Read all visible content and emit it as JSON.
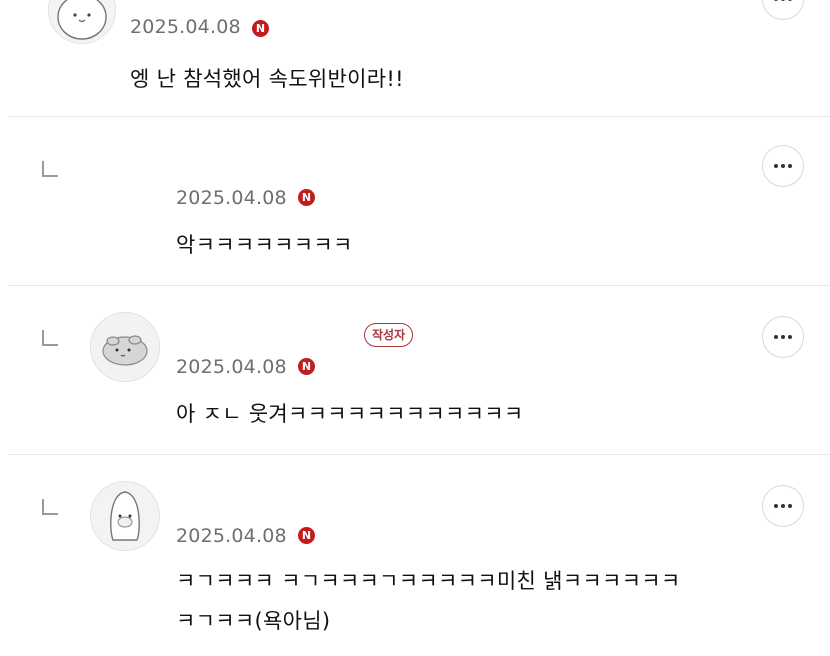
{
  "comments": [
    {
      "avatar_icon": "cat-avatar-icon",
      "date": "2025.04.08",
      "new_badge": "N",
      "text": "엥 난 참석했어 속도위반이라!!"
    },
    {
      "date": "2025.04.08",
      "new_badge": "N",
      "text": "악ㅋㅋㅋㅋㅋㅋㅋㅋ"
    },
    {
      "avatar_icon": "hamster-avatar-icon",
      "author_badge": "작성자",
      "date": "2025.04.08",
      "new_badge": "N",
      "text": "아 ㅈㄴ 웃겨ㅋㅋㅋㅋㅋㅋㅋㅋㅋㅋㅋㅋ"
    },
    {
      "avatar_icon": "penguin-avatar-icon",
      "date": "2025.04.08",
      "new_badge": "N",
      "text_line1": "ㅋㄱㅋㅋㅋ ㅋㄱㅋㅋㅋㄱㅋㅋㅋㅋㅋ미친 낽ㅋㅋㅋㅋㅋㅋ",
      "text_line2": "ㅋㄱㅋㅋ(욕아님)"
    }
  ],
  "more_button": {
    "icon": "more-options-icon"
  },
  "colors": {
    "badge_red": "#c11d1d",
    "author_badge": "#a8373b",
    "date_gray": "#6f6f6f",
    "separator": "#e6e6e6"
  }
}
